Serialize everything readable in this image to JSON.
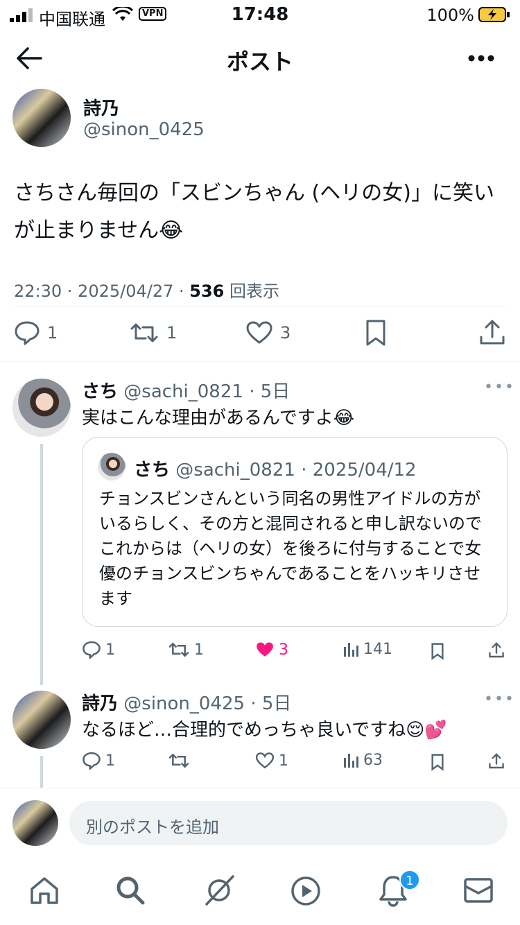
{
  "status_bar": {
    "carrier": "中国联通",
    "vpn": "VPN",
    "time": "17:48",
    "battery": "100%"
  },
  "header": {
    "title": "ポスト"
  },
  "post": {
    "name": "詩乃",
    "handle": "@sinon_0425",
    "text": "さちさん毎回の「スビンちゃん (ヘリの女)」に笑いが止まりません😂",
    "time": "22:30 · 2025/04/27 ·",
    "views": "536",
    "views_label": "回表示",
    "replies": "1",
    "reposts": "1",
    "likes": "3"
  },
  "reply1": {
    "name": "さち",
    "handle": "@sachi_0821",
    "age": "· 5日",
    "text": "実はこんな理由があるんですよ😂",
    "quote": {
      "name": "さち",
      "handle": "@sachi_0821",
      "date": "· 2025/04/12",
      "text": "チョンスビンさんという同名の男性アイドルの方がいるらしく、その方と混同されると申し訳ないのでこれからは（ヘリの女）を後ろに付与することで女優のチョンスビンちゃんであることをハッキリさせます"
    },
    "replies": "1",
    "reposts": "1",
    "likes": "3",
    "views": "141",
    "like_color": "#f91880"
  },
  "reply2": {
    "name": "詩乃",
    "handle": "@sinon_0425",
    "age": "· 5日",
    "text": "なるほど…合理的でめっちゃ良いですね😌💕",
    "replies": "1",
    "likes": "1",
    "views": "63"
  },
  "compose": {
    "placeholder": "別のポストを追加"
  },
  "tabbar": {
    "notifications_badge": "1",
    "icons": [
      "home-icon",
      "search-icon",
      "grok-icon",
      "video-icon",
      "bell-icon",
      "mail-icon"
    ]
  }
}
